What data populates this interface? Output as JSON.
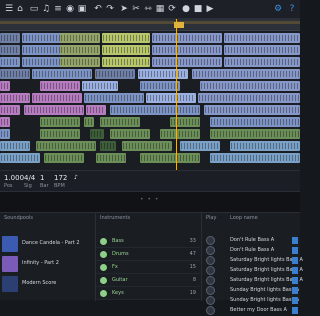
{
  "toolbar": {
    "buttons": [
      {
        "name": "menu-icon",
        "glyph": "☰"
      },
      {
        "name": "home-icon",
        "glyph": "⌂"
      },
      {
        "name": "folder-icon",
        "glyph": "▭"
      },
      {
        "name": "music-icon",
        "glyph": "♫"
      },
      {
        "name": "list-icon",
        "glyph": "≡"
      },
      {
        "name": "disc-icon",
        "glyph": "◉"
      },
      {
        "name": "media-icon",
        "glyph": "▣"
      },
      {
        "name": "undo-icon",
        "glyph": "↶"
      },
      {
        "name": "redo-icon",
        "glyph": "↷"
      },
      {
        "name": "pointer-icon",
        "glyph": "➤"
      },
      {
        "name": "cut-icon",
        "glyph": "✂"
      },
      {
        "name": "split-icon",
        "glyph": "⇿"
      },
      {
        "name": "grid-icon",
        "glyph": "▦"
      },
      {
        "name": "loop-icon",
        "glyph": "⟳"
      },
      {
        "name": "record-icon",
        "glyph": "●"
      },
      {
        "name": "stop-icon",
        "glyph": "■"
      },
      {
        "name": "play-icon",
        "glyph": "▶"
      },
      {
        "name": "settings-icon",
        "glyph": "⚙"
      },
      {
        "name": "help-icon",
        "glyph": "?"
      }
    ]
  },
  "transport": {
    "position": "1.000",
    "position_label": "Pos",
    "signature": "4/4",
    "signature_label": "Sig",
    "bar": "1",
    "bar_label": "Bar",
    "tempo": "172",
    "tempo_label": "BPM"
  },
  "browser": {
    "soundpools_header": "Soundpools",
    "instruments_header": "Instruments",
    "loops_header": "Loop name",
    "play_header": "Play",
    "soundpools": [
      {
        "name": "Dance Candela - Part 2",
        "color": "#3a5bb0"
      },
      {
        "name": "Infinity - Part 2",
        "color": "#7a5bb8"
      },
      {
        "name": "Modern Score",
        "color": "#2c3f73"
      }
    ],
    "instruments": [
      {
        "name": "Bass",
        "count": "33"
      },
      {
        "name": "Drums",
        "count": "47"
      },
      {
        "name": "Fx",
        "count": "15"
      },
      {
        "name": "Guitar",
        "count": "8"
      },
      {
        "name": "Keys",
        "count": "19"
      }
    ],
    "loops": [
      "Don't Rule Bass A",
      "Don't Rule Bass A",
      "Saturday Bright lights Bass A",
      "Saturday Bright lights Bass A",
      "Saturday Bright lights Bass A",
      "Sunday Bright lights Bass A",
      "Sunday Bright lights Bass A",
      "Better my Door Bass A"
    ]
  }
}
